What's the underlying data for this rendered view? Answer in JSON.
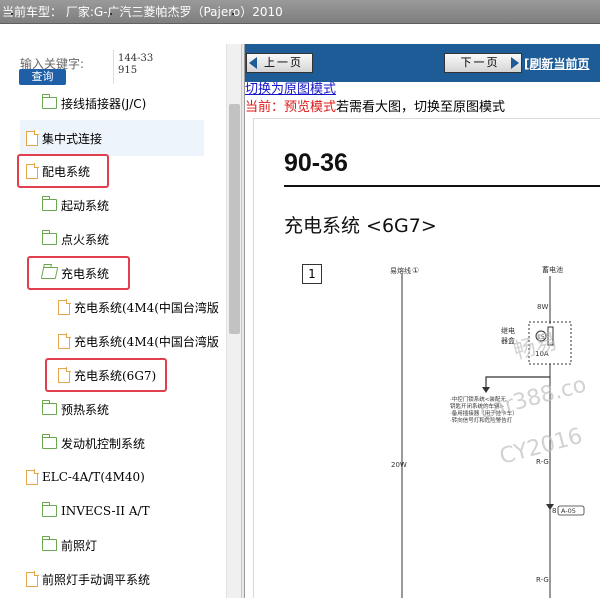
{
  "titlebar": {
    "text": "当前车型： 厂家:G-广汽三菱帕杰罗（Pajero）2010"
  },
  "search": {
    "label": "输入关键字:",
    "button": "查询",
    "value": "144-33915"
  },
  "tree": [
    {
      "label": "接线插接器(J/C)",
      "icon": "folder"
    },
    {
      "label": "集中式连接",
      "icon": "doc"
    },
    {
      "label": "配电系统",
      "icon": "doc"
    },
    {
      "label": "起动系统",
      "icon": "folder"
    },
    {
      "label": "点火系统",
      "icon": "folder"
    },
    {
      "label": "充电系统",
      "icon": "folder-open"
    },
    {
      "label": "充电系统(4M4(中国台湾版",
      "icon": "doc"
    },
    {
      "label": "充电系统(4M4(中国台湾版",
      "icon": "doc"
    },
    {
      "label": "充电系统(6G7)",
      "icon": "doc"
    },
    {
      "label": "预热系统",
      "icon": "folder"
    },
    {
      "label": "发动机控制系统",
      "icon": "folder"
    },
    {
      "label": "ELC-4A/T(4M40)",
      "icon": "doc"
    },
    {
      "label": "INVECS-II A/T",
      "icon": "folder"
    },
    {
      "label": "前照灯",
      "icon": "folder"
    },
    {
      "label": "前照灯手动调平系统",
      "icon": "doc"
    }
  ],
  "nav": {
    "prev": "上一页",
    "next": "下一页",
    "refresh": "[刷新当前页"
  },
  "mode": {
    "switch_link": "切换为原图模式",
    "current_prefix": "当前：",
    "current_mode": "预览模式",
    "current_suffix": "若需看大图，切换至原图模式"
  },
  "document": {
    "page_number": "90-36",
    "system_title": "充电系统 <6G7>",
    "box_number": "1",
    "label_fusible": "易熔线",
    "label_fusible_num": "①",
    "label_battery": "蓄电池",
    "wire_8w": "8W",
    "relay_label_1": "继电",
    "relay_label_2": "器盒",
    "fuse_num": "15",
    "fuse_amp": "10A",
    "note_1": "·中控门锁系统<装配无",
    "note_2": "钥匙开闭系统的车辆>",
    "note_3": "·备用插接器（用于挂卡车）",
    "note_4": "·转向信号灯和危险警告灯",
    "wire_20w": "20W",
    "wire_rg_1": "R-G",
    "conn_num": "8",
    "conn_id": "A-05",
    "wire_rg_2": "R-G"
  },
  "watermark": {
    "line1": "畅易",
    "line2": "car388.co",
    "line3": "CY2016"
  },
  "colors": {
    "navbar": "#1d5c96",
    "highlight_box": "#e0404e",
    "mode_red": "#e01a1a",
    "link_blue": "#1515c8"
  }
}
